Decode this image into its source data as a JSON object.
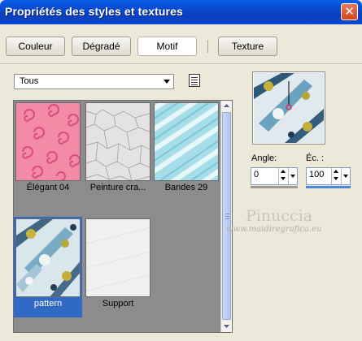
{
  "window": {
    "title": "Propriétés des styles et textures",
    "close_label": "✕"
  },
  "tabs": [
    {
      "label": "Couleur",
      "active": false
    },
    {
      "label": "Dégradé",
      "active": false
    },
    {
      "label": "Motif",
      "active": true
    },
    {
      "label": "Texture",
      "active": false
    }
  ],
  "category": {
    "selected": "Tous"
  },
  "gallery": {
    "items": [
      {
        "caption": "Élégant 04",
        "icon": "pink-swirl-pattern",
        "selected": false
      },
      {
        "caption": "Peinture cra...",
        "icon": "crackle-paint-pattern",
        "selected": false
      },
      {
        "caption": "Bandes 29",
        "icon": "blue-stripes-pattern",
        "selected": false
      },
      {
        "caption": "pattern",
        "icon": "blue-floral-pattern",
        "selected": true
      },
      {
        "caption": "Support",
        "icon": "white-texture-pattern",
        "selected": false
      }
    ]
  },
  "params": {
    "angle_label": "Angle:",
    "angle_value": "0",
    "scale_label": "Éc. :",
    "scale_value": "100"
  },
  "watermark": {
    "name": "Pinuccia",
    "url": "www.maidiregrafica.eu"
  },
  "colors": {
    "accent": "#316ac5",
    "title_bar": "#0846c8",
    "gallery_bg": "#8c8c8c"
  }
}
